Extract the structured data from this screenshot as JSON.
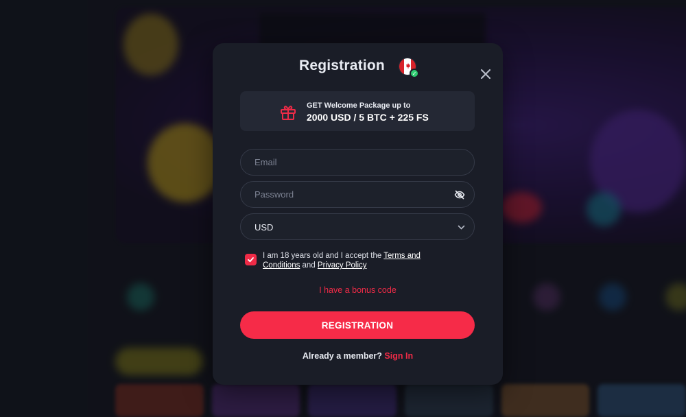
{
  "modal": {
    "title": "Registration",
    "promo": {
      "line1": "GET Welcome Package up to",
      "line2": "2000 USD / 5 BTC + 225 FS"
    },
    "email": {
      "placeholder": "Email"
    },
    "password": {
      "placeholder": "Password"
    },
    "currency": {
      "value": "USD"
    },
    "agreement": {
      "text_before": "I am 18 years old and I accept the ",
      "terms_link": "Terms and Conditions",
      "text_middle": " and ",
      "privacy_link": "Privacy Policy",
      "checked": true
    },
    "bonus_code_link": "I have a bonus code",
    "submit_label": "REGISTRATION",
    "footer": {
      "text": "Already a member?",
      "signin_link": "Sign In"
    }
  },
  "icons": [
    "canada-flag-icon",
    "verified-check-icon",
    "close-icon",
    "gift-icon",
    "eye-off-icon",
    "chevron-down-icon",
    "checkmark-icon"
  ],
  "colors": {
    "accent": "#f62b48",
    "modal_bg": "#1a1d27",
    "promo_bg": "#242834",
    "field_border": "#353a48"
  }
}
